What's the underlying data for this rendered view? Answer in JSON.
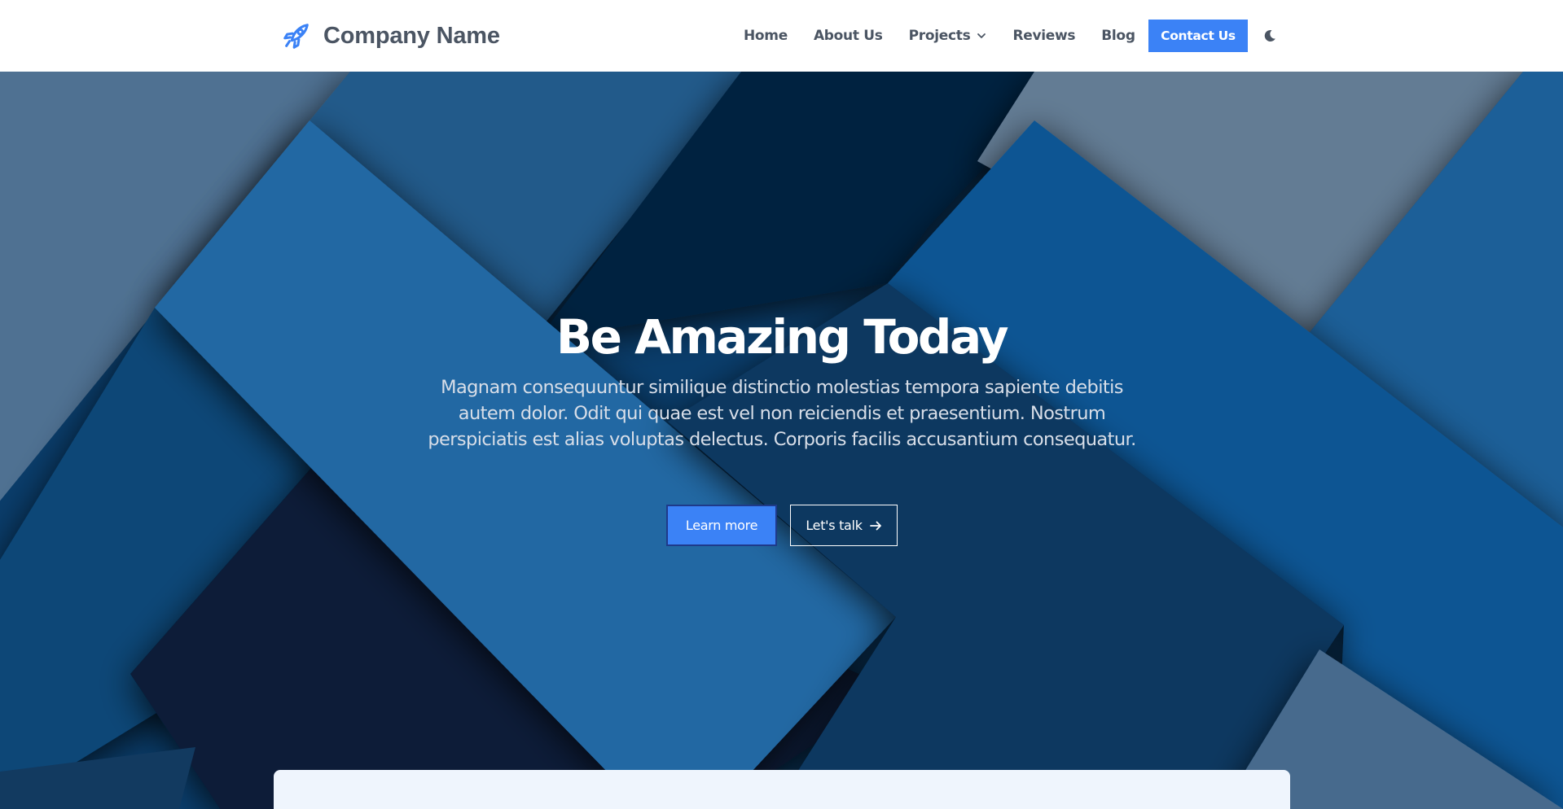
{
  "brand": {
    "name": "Company Name",
    "icon": "rocket-icon"
  },
  "nav": {
    "items": [
      {
        "label": "Home"
      },
      {
        "label": "About Us"
      },
      {
        "label": "Projects",
        "has_dropdown": true
      },
      {
        "label": "Reviews"
      },
      {
        "label": "Blog"
      }
    ],
    "contact_label": "Contact Us",
    "theme_toggle_icon": "moon-icon"
  },
  "hero": {
    "title": "Be Amazing Today",
    "text": "Magnam consequuntur similique distinctio molestias tempora sapiente debitis autem dolor. Odit qui quae est vel non reiciendis et praesentium. Nostrum perspiciatis est alias voluptas delectus. Corporis facilis accusantium consequatur.",
    "primary_button": "Learn more",
    "secondary_button": "Let's talk",
    "secondary_icon": "arrow-right-icon"
  },
  "colors": {
    "accent": "#3b82f6",
    "nav_text": "#4b5563",
    "hero_dark": "#06203a",
    "hero_mid": "#2367a2",
    "hero_gray": "#4f7192"
  }
}
